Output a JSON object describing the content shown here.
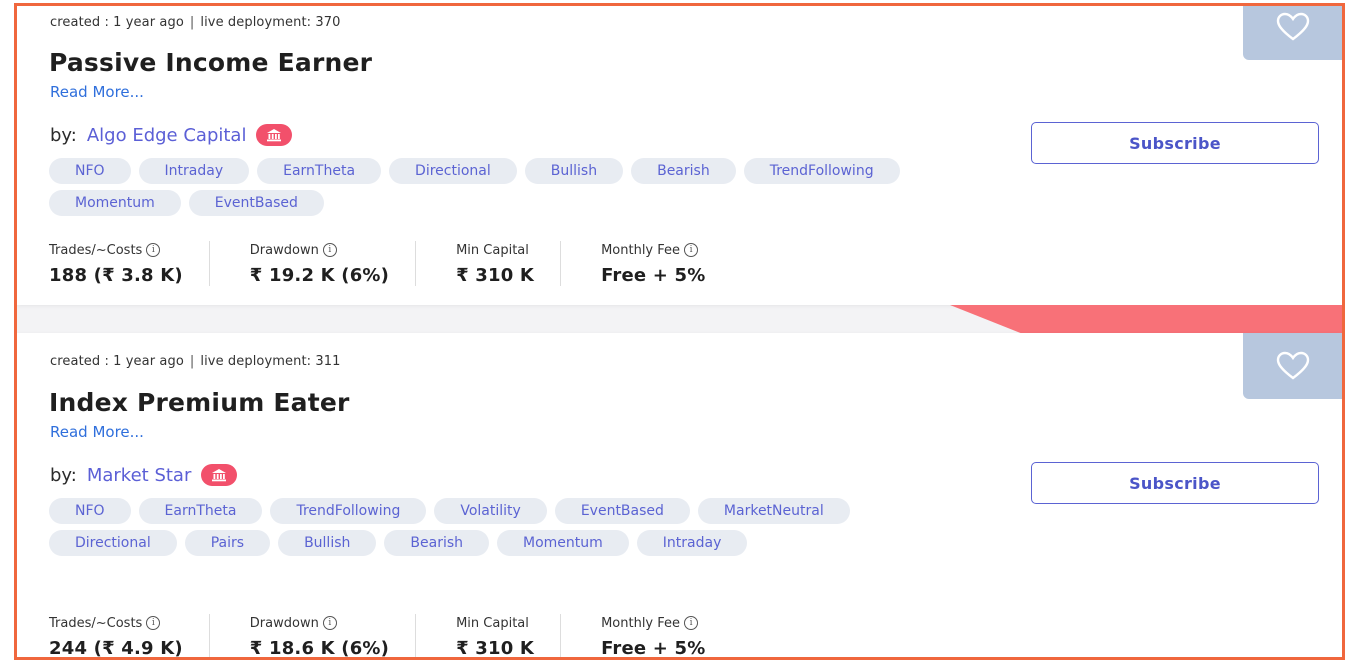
{
  "strategies": [
    {
      "meta": {
        "created": "created : 1 year ago",
        "separator": "|",
        "live": "live deployment: 370"
      },
      "title": "Passive Income Earner",
      "read_more": "Read More...",
      "by_label": "by:",
      "author": "Algo Edge Capital",
      "author_badge_icon": "bank-icon",
      "subscribe_label": "Subscribe",
      "tags": [
        "NFO",
        "Intraday",
        "EarnTheta",
        "Directional",
        "Bullish",
        "Bearish",
        "TrendFollowing",
        "Momentum",
        "EventBased"
      ],
      "stats": [
        {
          "label": "Trades/~Costs",
          "value": "188 (₹ 3.8 K)",
          "info": true
        },
        {
          "label": "Drawdown",
          "value": "₹ 19.2 K (6%)",
          "info": true
        },
        {
          "label": "Min Capital",
          "value": "₹ 310 K",
          "info": false
        },
        {
          "label": "Monthly Fee",
          "value": "Free + 5%",
          "info": true
        }
      ]
    },
    {
      "meta": {
        "created": "created : 1 year ago",
        "separator": "|",
        "live": "live deployment: 311"
      },
      "title": "Index Premium Eater",
      "read_more": "Read More...",
      "by_label": "by:",
      "author": "Market Star",
      "author_badge_icon": "bank-icon",
      "subscribe_label": "Subscribe",
      "tags": [
        "NFO",
        "EarnTheta",
        "TrendFollowing",
        "Volatility",
        "EventBased",
        "MarketNeutral",
        "Directional",
        "Pairs",
        "Bullish",
        "Bearish",
        "Momentum",
        "Intraday"
      ],
      "stats": [
        {
          "label": "Trades/~Costs",
          "value": "244 (₹ 4.9 K)",
          "info": true
        },
        {
          "label": "Drawdown",
          "value": "₹ 18.6 K (6%)",
          "info": true
        },
        {
          "label": "Min Capital",
          "value": "₹ 310 K",
          "info": false
        },
        {
          "label": "Monthly Fee",
          "value": "Free + 5%",
          "info": true
        }
      ]
    }
  ],
  "info_icon_glyph": "i",
  "colors": {
    "accent": "#5b63d3",
    "link": "#2f6fdc",
    "badge": "#f2506b",
    "tag_bg": "#e8ecf2",
    "heart_tab": "#b7c7de",
    "frame": "#f0673d"
  }
}
